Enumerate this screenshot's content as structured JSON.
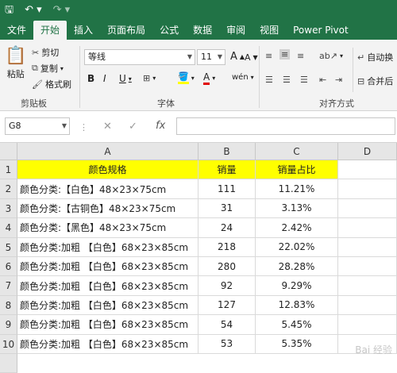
{
  "qat": {
    "save_icon": "save-icon",
    "undo_icon": "undo-icon",
    "redo_icon": "redo-icon"
  },
  "tabs": [
    {
      "label": "文件",
      "active": false
    },
    {
      "label": "开始",
      "active": true
    },
    {
      "label": "插入",
      "active": false
    },
    {
      "label": "页面布局",
      "active": false
    },
    {
      "label": "公式",
      "active": false
    },
    {
      "label": "数据",
      "active": false
    },
    {
      "label": "审阅",
      "active": false
    },
    {
      "label": "视图",
      "active": false
    },
    {
      "label": "Power Pivot",
      "active": false
    }
  ],
  "ribbon": {
    "clipboard": {
      "paste": "粘贴",
      "cut": "剪切",
      "copy": "复制",
      "format_painter": "格式刷",
      "group": "剪贴板"
    },
    "font": {
      "name": "等线",
      "size": "11",
      "grow": "A",
      "shrink": "A",
      "bold": "B",
      "italic": "I",
      "underline": "U",
      "fill_letter": "A",
      "phonetic": "wén",
      "group": "字体"
    },
    "alignment": {
      "wrap": "自动换",
      "merge": "合并后",
      "group": "对齐方式"
    }
  },
  "formula_bar": {
    "name_box": "G8",
    "cancel": "✕",
    "confirm": "✓",
    "fx": "fx",
    "value": ""
  },
  "columns": [
    "A",
    "B",
    "C",
    "D"
  ],
  "rows": [
    "1",
    "2",
    "3",
    "4",
    "5",
    "6",
    "7",
    "8",
    "9",
    "10"
  ],
  "table": {
    "headers": [
      "颜色规格",
      "销量",
      "销量占比"
    ],
    "rows": [
      [
        "颜色分类:【白色】48×23×75cm",
        "111",
        "11.21%"
      ],
      [
        "颜色分类:【古铜色】48×23×75cm",
        "31",
        "3.13%"
      ],
      [
        "颜色分类:【黑色】48×23×75cm",
        "24",
        "2.42%"
      ],
      [
        "颜色分类:加粗 【白色】68×23×85cm",
        "218",
        "22.02%"
      ],
      [
        "颜色分类:加粗 【白色】68×23×85cm",
        "280",
        "28.28%"
      ],
      [
        "颜色分类:加粗 【白色】68×23×85cm",
        "92",
        "9.29%"
      ],
      [
        "颜色分类:加粗 【白色】68×23×85cm",
        "127",
        "12.83%"
      ],
      [
        "颜色分类:加粗 【白色】68×23×85cm",
        "54",
        "5.45%"
      ],
      [
        "颜色分类:加粗 【白色】68×23×85cm",
        "53",
        "5.35%"
      ]
    ]
  },
  "watermark": "Bai 经验",
  "colors": {
    "accent": "#217346",
    "header_fill": "#ffff00"
  }
}
